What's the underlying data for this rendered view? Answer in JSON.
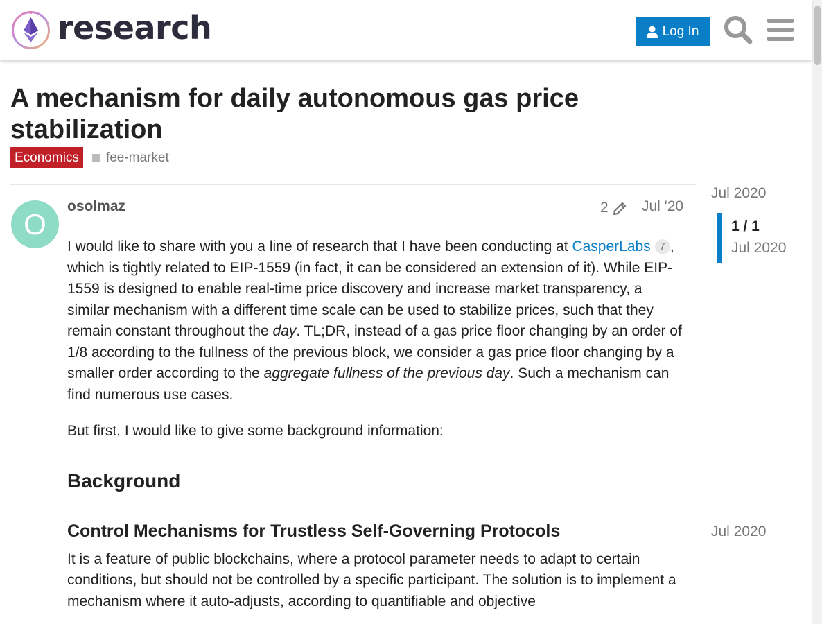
{
  "header": {
    "site_name": "research",
    "login_label": "Log In"
  },
  "topic": {
    "title": "A mechanism for daily autonomous gas price stabilization",
    "category": "Economics",
    "tag": "fee-market"
  },
  "post": {
    "username": "osolmaz",
    "avatar_letter": "O",
    "edit_count": "2",
    "date": "Jul '20",
    "p1_start": "I would like to share with you a line of research that I have been conducting at ",
    "p1_link": "CasperLabs",
    "p1_link_clicks": "7",
    "p1_mid": ", which is tightly related to EIP-1559 (in fact, it can be considered an extension of it). While EIP-1559 is designed to enable real-time price discovery and increase market transparency, a similar mechanism with a different time scale can be used to stabilize prices, such that they remain constant throughout the ",
    "p1_em1": "day",
    "p1_mid2": ". TL;DR, instead of a gas price floor changing by an order of 1/8 according to the fullness of the previous block, we consider a gas price floor changing by a smaller order according to the ",
    "p1_em2": "aggregate fullness of the previous day",
    "p1_end": ". Such a mechanism can find numerous use cases.",
    "p2": "But first, I would like to give some background information:",
    "h_background": "Background",
    "h_control": "Control Mechanisms for Trustless Self-Governing Protocols",
    "p3": "It is a feature of public blockchains, where a protocol parameter needs to adapt to certain conditions, but should not be controlled by a specific participant. The solution is to implement a mechanism where it auto-adjusts, according to quantifiable and objective"
  },
  "timeline": {
    "start_date": "Jul 2020",
    "position": "1 / 1",
    "position_date": "Jul 2020",
    "end_date": "Jul 2020"
  },
  "colors": {
    "accent": "#0a7fc8",
    "category": "#c12028",
    "avatar": "#8fdcc6"
  }
}
